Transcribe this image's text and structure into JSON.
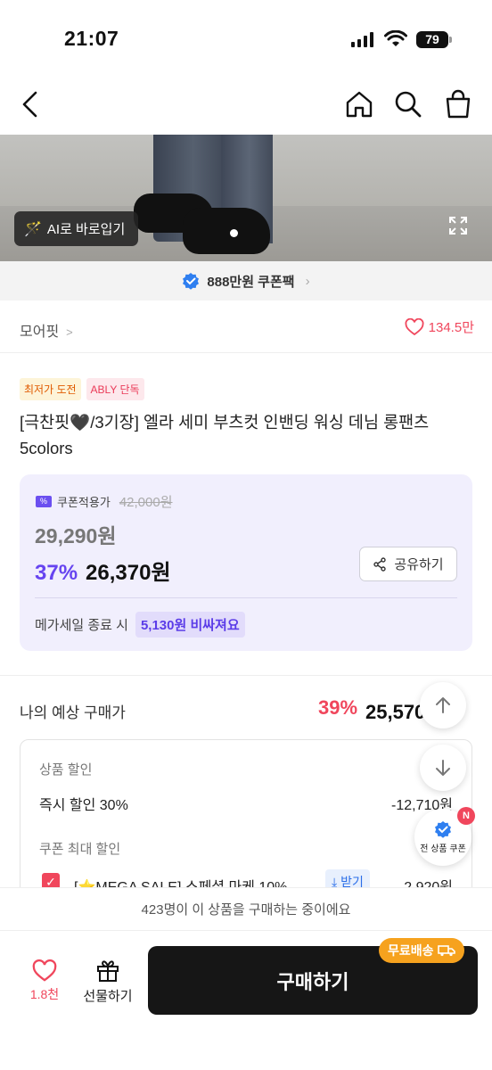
{
  "status_bar": {
    "time": "21:07",
    "battery": "79"
  },
  "hero": {
    "ai_button_label": "AI로 바로입기"
  },
  "coupon_pack": {
    "label": "888만원 쿠폰팩"
  },
  "brand": {
    "name": "모어핏",
    "likes": "134.5만"
  },
  "badges": [
    "최저가 도전",
    "ABLY 단독"
  ],
  "product": {
    "title": "[극찬핏🖤/3기장] 엘라 세미 부츠컷 인밴딩 워싱 데님 롱팬츠 5colors"
  },
  "price": {
    "coupon_label": "쿠폰적용가",
    "original_price": "42,000원",
    "coupon_price": "29,290원",
    "discount_pct": "37%",
    "final_price": "26,370원",
    "share_label": "공유하기",
    "mega_sale_text": "메가세일 종료 시",
    "mega_sale_highlight": "5,130원 비싸져요"
  },
  "expected": {
    "label": "나의 예상 구매가",
    "pct": "39%",
    "value": "25,570원"
  },
  "discounts": {
    "product_discount_label": "상품 할인",
    "instant_label": "즉시 할인 30%",
    "instant_amount": "-12,710원",
    "coupon_max_label": "쿠폰 최대 할인",
    "coupon_item_label": "[⭐MEGA SALE] 스페셜 마케 10%",
    "coupon_download": "받기",
    "coupon_amount": "-2,920원"
  },
  "floating": {
    "coupon_label": "전 상품 쿠폰",
    "badge": "N"
  },
  "buyers": {
    "text": "423명이 이 상품을 구매하는 중이에요"
  },
  "bottom": {
    "like_count": "1.8천",
    "gift_label": "선물하기",
    "buy_label": "구매하기",
    "free_shipping": "무료배송"
  },
  "colors": {
    "accent_purple": "#6644f0",
    "accent_red": "#f0465c",
    "shipping_orange": "#f6a21e"
  }
}
